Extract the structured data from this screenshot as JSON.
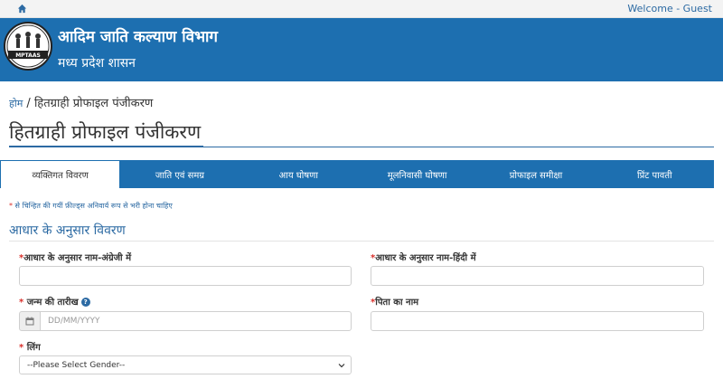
{
  "topbar": {
    "welcome": "Welcome - Guest"
  },
  "header": {
    "dept_name": "आदिम जाति कल्याण विभाग",
    "gov_name": "मध्य प्रदेश शासन",
    "logo_text": "MPTAAS"
  },
  "breadcrumb": {
    "home": "होम",
    "separator": " / ",
    "current": "हितग्राही प्रोफाइल पंजीकरण"
  },
  "page_title": "हितग्राही प्रोफाइल पंजीकरण",
  "tabs": [
    {
      "label": "व्यक्तिगत विवरण",
      "active": true
    },
    {
      "label": "जाति एवं समग्र"
    },
    {
      "label": "आय घोषणा"
    },
    {
      "label": "मूलनिवासी घोषणा"
    },
    {
      "label": "प्रोफाइल समीक्षा"
    },
    {
      "label": "प्रिंट पावती"
    }
  ],
  "required_note": "से चिन्हित की गयीं फ़ील्ड्स अनिवार्य रूप से भरी होना चाहिए",
  "section_title": "आधार के अनुसार विवरण",
  "fields": {
    "name_english": {
      "label": "आधार के अनुसार नाम-अंग्रेजी में"
    },
    "name_hindi": {
      "label": "आधार के अनुसार नाम-हिंदी में"
    },
    "dob": {
      "label": "जन्म की तारीख",
      "placeholder": "DD/MM/YYYY"
    },
    "father_name": {
      "label": "पिता का नाम"
    },
    "gender": {
      "label": "लिंग",
      "selected": "--Please Select Gender--"
    }
  },
  "colors": {
    "primary": "#1d6fb0",
    "required": "#d9302b",
    "link": "#2c6aa3"
  }
}
